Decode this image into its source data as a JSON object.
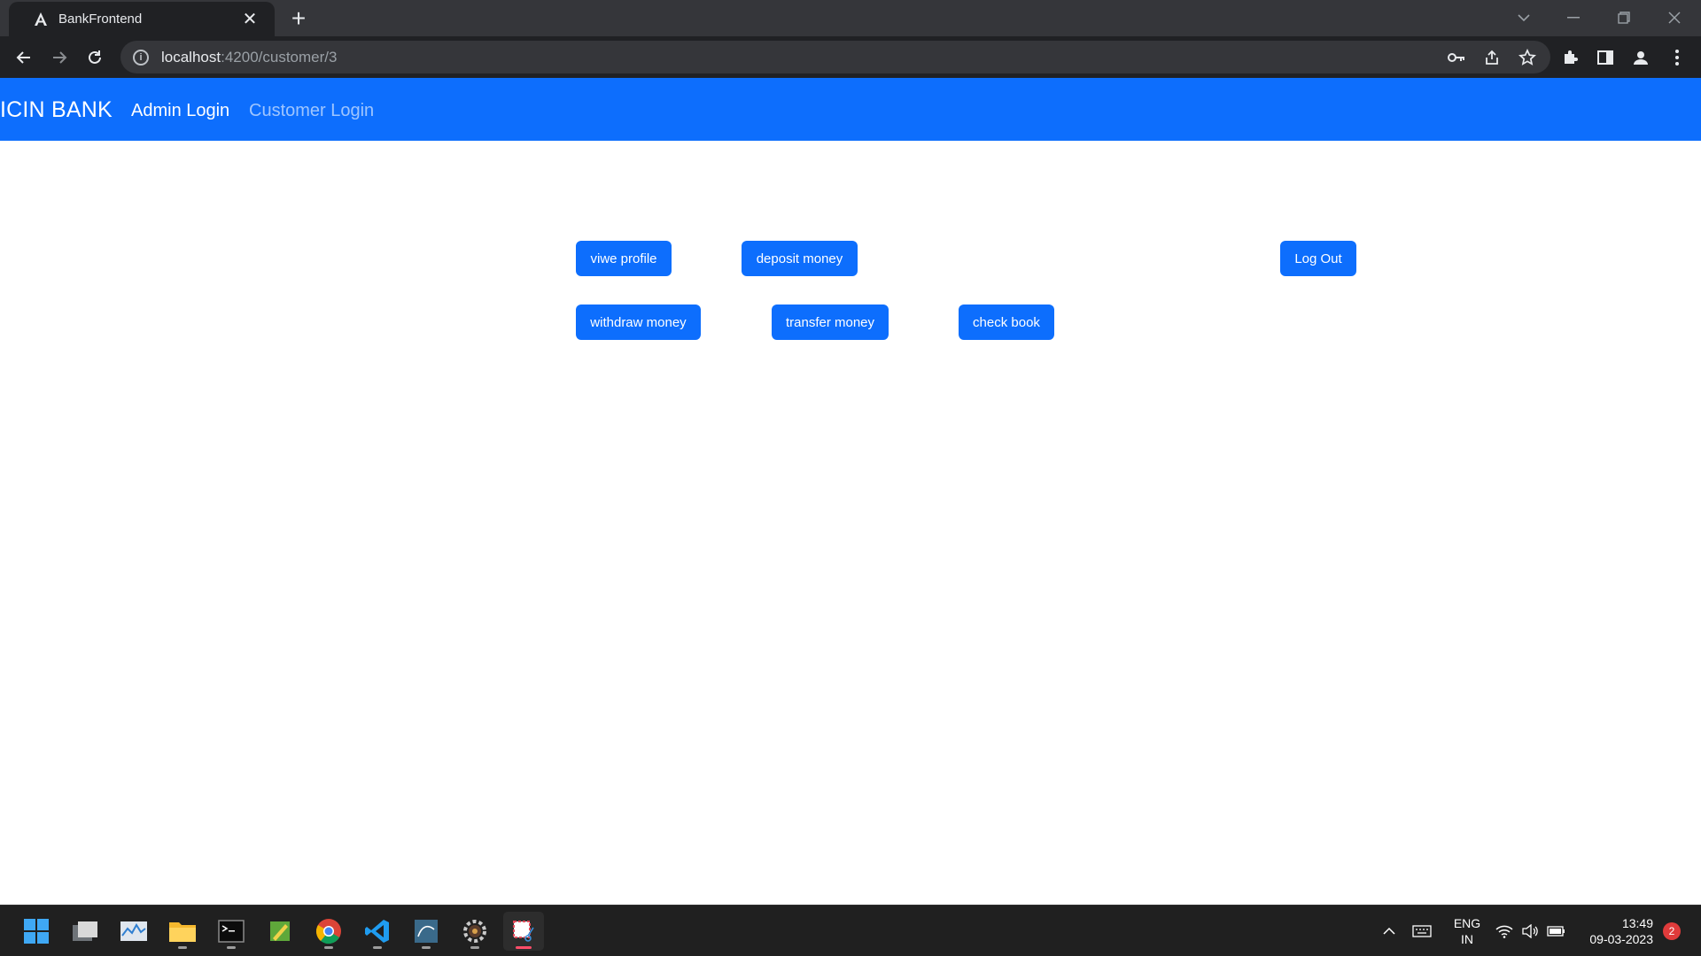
{
  "browser": {
    "tab_title": "BankFrontend",
    "url_host": "localhost",
    "url_path": ":4200/customer/3"
  },
  "navbar": {
    "brand": "ICIN BANK",
    "links": [
      "Admin Login",
      "Customer Login"
    ],
    "color": "#0d6efd"
  },
  "actions": {
    "view_profile": "viwe profile",
    "deposit_money": "deposit money",
    "log_out": "Log Out",
    "withdraw_money": "withdraw money",
    "transfer_money": "transfer money",
    "check_book": "check book"
  },
  "taskbar": {
    "language": [
      "ENG",
      "IN"
    ],
    "time": "13:49",
    "date": "09-03-2023",
    "notification_count": "2",
    "apps": [
      "start-icon",
      "task-view-icon",
      "task-manager-icon",
      "file-explorer-icon",
      "terminal-icon",
      "notepad-icon",
      "chrome-icon",
      "vscode-icon",
      "mysql-workbench-icon",
      "settings-app-icon",
      "snipping-tool-icon"
    ]
  }
}
